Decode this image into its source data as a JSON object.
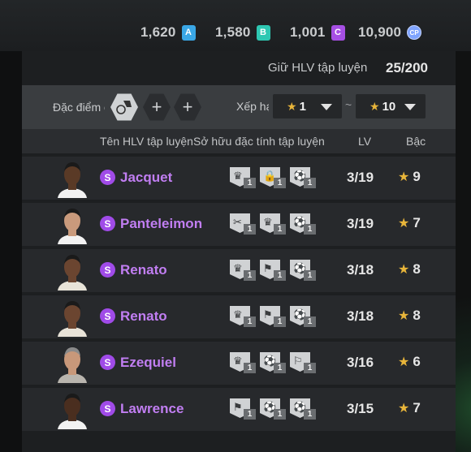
{
  "currencies": [
    {
      "amount": "1,620",
      "badge": "A",
      "color": "#3aa7e6"
    },
    {
      "amount": "1,580",
      "badge": "B",
      "color": "#2ec7b2"
    },
    {
      "amount": "1,001",
      "badge": "C",
      "color": "#a64fe4"
    },
    {
      "amount": "10,900",
      "badge": "CP",
      "color": "#7fa4ff"
    }
  ],
  "coach": {
    "label": "Giữ HLV tập luyện",
    "count": "25/200"
  },
  "filter": {
    "trait_label": "Đặc điểm c",
    "sort_label": "Xếp hạ",
    "from_value": "1",
    "to_value": "10",
    "separator": "~"
  },
  "columns": {
    "name": "Tên HLV tập luyện",
    "traits": "Sở hữu đặc tính tập luyện",
    "level": "LV",
    "grade": "Bậc"
  },
  "coaches": [
    {
      "name": "Jacquet",
      "level": "3/19",
      "grade": "9",
      "traits": [
        "trophy-icon",
        "lock-icon",
        "boot-icon"
      ],
      "trait_counts": [
        "1",
        "1",
        "1"
      ]
    },
    {
      "name": "Panteleimon",
      "level": "3/19",
      "grade": "7",
      "traits": [
        "scissors-icon",
        "trophy-icon",
        "boot-icon"
      ],
      "trait_counts": [
        "1",
        "1",
        "1"
      ]
    },
    {
      "name": "Renato",
      "level": "3/18",
      "grade": "8",
      "traits": [
        "trophy-icon",
        "tie-icon",
        "boot-icon"
      ],
      "trait_counts": [
        "1",
        "1",
        "1"
      ]
    },
    {
      "name": "Renato",
      "level": "3/18",
      "grade": "8",
      "traits": [
        "trophy-icon",
        "tie-icon",
        "boot-icon"
      ],
      "trait_counts": [
        "1",
        "1",
        "1"
      ]
    },
    {
      "name": "Ezequiel",
      "level": "3/16",
      "grade": "6",
      "traits": [
        "trophy-icon",
        "boot-icon",
        "player-icon"
      ],
      "trait_counts": [
        "1",
        "1",
        "1"
      ]
    },
    {
      "name": "Lawrence",
      "level": "3/15",
      "grade": "7",
      "traits": [
        "tie-icon",
        "boot-icon",
        "kick-icon"
      ],
      "trait_counts": [
        "1",
        "1",
        "1"
      ]
    }
  ],
  "accent": {
    "star": "#e8b53a",
    "name": "#c17ef2",
    "rarity": "#a04be8"
  }
}
